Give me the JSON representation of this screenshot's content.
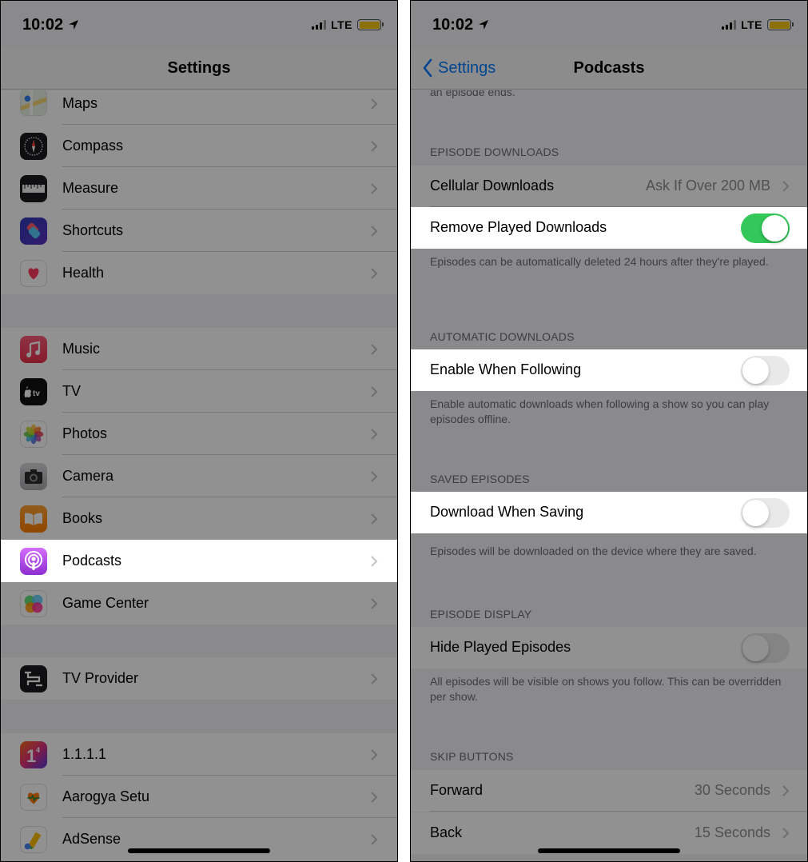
{
  "left": {
    "status": {
      "time": "10:02",
      "network": "LTE"
    },
    "nav_title": "Settings",
    "groups": [
      [
        {
          "label": "Maps",
          "icon": "maps-icon"
        },
        {
          "label": "Compass",
          "icon": "compass-icon"
        },
        {
          "label": "Measure",
          "icon": "measure-icon"
        },
        {
          "label": "Shortcuts",
          "icon": "shortcuts-icon"
        },
        {
          "label": "Health",
          "icon": "health-icon"
        }
      ],
      [
        {
          "label": "Music",
          "icon": "music-icon"
        },
        {
          "label": "TV",
          "icon": "tv-icon"
        },
        {
          "label": "Photos",
          "icon": "photos-icon"
        },
        {
          "label": "Camera",
          "icon": "camera-icon"
        },
        {
          "label": "Books",
          "icon": "books-icon"
        },
        {
          "label": "Podcasts",
          "icon": "podcasts-icon",
          "highlighted": true
        },
        {
          "label": "Game Center",
          "icon": "game-center-icon"
        }
      ],
      [
        {
          "label": "TV Provider",
          "icon": "tv-provider-icon"
        }
      ],
      [
        {
          "label": "1.1.1.1",
          "icon": "cloudflare-1111-icon"
        },
        {
          "label": "Aarogya Setu",
          "icon": "aarogya-setu-icon"
        },
        {
          "label": "AdSense",
          "icon": "adsense-icon"
        }
      ]
    ]
  },
  "right": {
    "status": {
      "time": "10:02",
      "network": "LTE"
    },
    "back_label": "Settings",
    "nav_title": "Podcasts",
    "top_footer_partial": "an episode ends.",
    "sections": {
      "episode_downloads": {
        "header": "EPISODE DOWNLOADS",
        "cellular_label": "Cellular Downloads",
        "cellular_value": "Ask If Over 200 MB",
        "remove_label": "Remove Played Downloads",
        "remove_on": true,
        "footer": "Episodes can be automatically deleted 24 hours after they're played."
      },
      "automatic_downloads": {
        "header": "AUTOMATIC DOWNLOADS",
        "label": "Enable When Following",
        "on": false,
        "footer": "Enable automatic downloads when following a show so you can play episodes offline."
      },
      "saved_episodes": {
        "header": "SAVED EPISODES",
        "label": "Download When Saving",
        "on": false,
        "footer": "Episodes will be downloaded on the device where they are saved."
      },
      "episode_display": {
        "header": "EPISODE DISPLAY",
        "label": "Hide Played Episodes",
        "on": false,
        "footer": "All episodes will be visible on shows you follow. This can be overridden per show."
      },
      "skip_buttons": {
        "header": "SKIP BUTTONS",
        "forward_label": "Forward",
        "forward_value": "30 Seconds",
        "back_label": "Back",
        "back_value": "15 Seconds"
      }
    }
  },
  "colors": {
    "accent_blue": "#007aff",
    "toggle_on": "#34c759",
    "podcasts_purple": "#b150e2",
    "dim_overlay": "rgba(0,0,0,0.43)"
  }
}
